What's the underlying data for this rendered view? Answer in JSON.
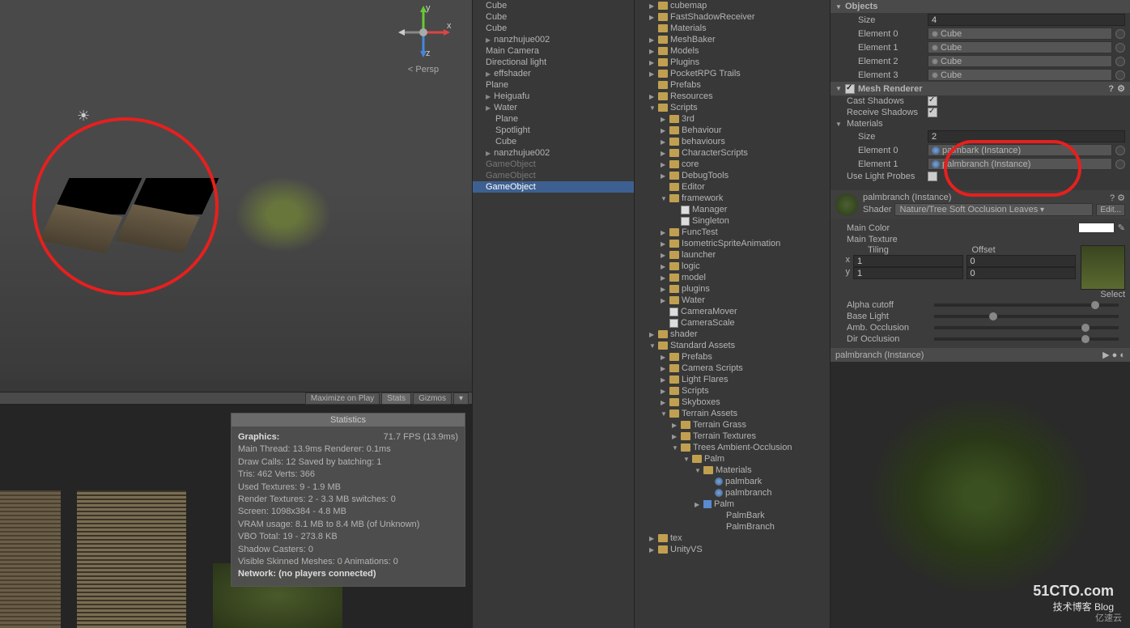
{
  "scene": {
    "gizmo_axes": {
      "x": "x",
      "y": "y",
      "z": "z"
    },
    "persp_label": "< Persp"
  },
  "game_toolbar": {
    "maximize": "Maximize on Play",
    "stats": "Stats",
    "gizmos": "Gizmos"
  },
  "stats": {
    "title": "Statistics",
    "graphics_label": "Graphics:",
    "fps": "71.7 FPS (13.9ms)",
    "line1": "Main Thread: 13.9ms   Renderer: 0.1ms",
    "line2": "Draw Calls: 12        Saved by batching: 1",
    "line3": "Tris: 462  Verts: 366",
    "line4": "Used Textures: 9 - 1.9 MB",
    "line5": "Render Textures: 2 - 3.3 MB      switches: 0",
    "line6": "Screen: 1098x384 - 4.8 MB",
    "line7": "VRAM usage: 8.1 MB to 8.4 MB (of Unknown)",
    "line8": "VBO Total: 19 - 273.8 KB",
    "line9": "Shadow Casters: 0",
    "line10": "Visible Skinned Meshes: 0        Animations: 0",
    "network": "Network: (no players connected)"
  },
  "hierarchy": [
    {
      "label": "Cube",
      "indent": 0
    },
    {
      "label": "Cube",
      "indent": 0
    },
    {
      "label": "Cube",
      "indent": 0
    },
    {
      "label": "nanzhujue002",
      "indent": 0,
      "expand": true
    },
    {
      "label": "Main Camera",
      "indent": 0
    },
    {
      "label": "Directional light",
      "indent": 0
    },
    {
      "label": "effshader",
      "indent": 0,
      "expand": true
    },
    {
      "label": "Plane",
      "indent": 0
    },
    {
      "label": "Heiguafu",
      "indent": 0,
      "expand": true
    },
    {
      "label": "Water",
      "indent": 0,
      "expand": true
    },
    {
      "label": "Plane",
      "indent": 1
    },
    {
      "label": "Spotlight",
      "indent": 1
    },
    {
      "label": "Cube",
      "indent": 1
    },
    {
      "label": "nanzhujue002",
      "indent": 0,
      "expand": true
    },
    {
      "label": "GameObject",
      "indent": 0,
      "dim": true
    },
    {
      "label": "GameObject",
      "indent": 0,
      "dim": true
    },
    {
      "label": "GameObject",
      "indent": 0,
      "sel": true
    }
  ],
  "project": [
    {
      "l": "cubemap",
      "i": 1,
      "f": true,
      "a": "▶"
    },
    {
      "l": "FastShadowReceiver",
      "i": 1,
      "f": true,
      "a": "▶"
    },
    {
      "l": "Materials",
      "i": 1,
      "f": true,
      "a": ""
    },
    {
      "l": "MeshBaker",
      "i": 1,
      "f": true,
      "a": "▶"
    },
    {
      "l": "Models",
      "i": 1,
      "f": true,
      "a": "▶"
    },
    {
      "l": "Plugins",
      "i": 1,
      "f": true,
      "a": "▶"
    },
    {
      "l": "PocketRPG Trails",
      "i": 1,
      "f": true,
      "a": "▶"
    },
    {
      "l": "Prefabs",
      "i": 1,
      "f": true,
      "a": ""
    },
    {
      "l": "Resources",
      "i": 1,
      "f": true,
      "a": "▶"
    },
    {
      "l": "Scripts",
      "i": 1,
      "f": true,
      "a": "▼"
    },
    {
      "l": "3rd",
      "i": 2,
      "f": true,
      "a": "▶"
    },
    {
      "l": "Behaviour",
      "i": 2,
      "f": true,
      "a": "▶"
    },
    {
      "l": "behaviours",
      "i": 2,
      "f": true,
      "a": "▶"
    },
    {
      "l": "CharacterScripts",
      "i": 2,
      "f": true,
      "a": "▶"
    },
    {
      "l": "core",
      "i": 2,
      "f": true,
      "a": "▶"
    },
    {
      "l": "DebugTools",
      "i": 2,
      "f": true,
      "a": "▶"
    },
    {
      "l": "Editor",
      "i": 2,
      "f": true,
      "a": ""
    },
    {
      "l": "framework",
      "i": 2,
      "f": true,
      "a": "▼"
    },
    {
      "l": "Manager",
      "i": 3,
      "s": true
    },
    {
      "l": "Singleton",
      "i": 3,
      "s": true
    },
    {
      "l": "FuncTest",
      "i": 2,
      "f": true,
      "a": "▶"
    },
    {
      "l": "IsometricSpriteAnimation",
      "i": 2,
      "f": true,
      "a": "▶"
    },
    {
      "l": "launcher",
      "i": 2,
      "f": true,
      "a": "▶"
    },
    {
      "l": "logic",
      "i": 2,
      "f": true,
      "a": "▶"
    },
    {
      "l": "model",
      "i": 2,
      "f": true,
      "a": "▶"
    },
    {
      "l": "plugins",
      "i": 2,
      "f": true,
      "a": "▶"
    },
    {
      "l": "Water",
      "i": 2,
      "f": true,
      "a": "▶"
    },
    {
      "l": "CameraMover",
      "i": 2,
      "s": true
    },
    {
      "l": "CameraScale",
      "i": 2,
      "s": true
    },
    {
      "l": "shader",
      "i": 1,
      "f": true,
      "a": "▶"
    },
    {
      "l": "Standard Assets",
      "i": 1,
      "f": true,
      "a": "▼"
    },
    {
      "l": "Prefabs",
      "i": 2,
      "f": true,
      "a": "▶"
    },
    {
      "l": "Camera Scripts",
      "i": 2,
      "f": true,
      "a": "▶"
    },
    {
      "l": "Light Flares",
      "i": 2,
      "f": true,
      "a": "▶"
    },
    {
      "l": "Scripts",
      "i": 2,
      "f": true,
      "a": "▶"
    },
    {
      "l": "Skyboxes",
      "i": 2,
      "f": true,
      "a": "▶"
    },
    {
      "l": "Terrain Assets",
      "i": 2,
      "f": true,
      "a": "▼"
    },
    {
      "l": "Terrain Grass",
      "i": 3,
      "f": true,
      "a": "▶"
    },
    {
      "l": "Terrain Textures",
      "i": 3,
      "f": true,
      "a": "▶"
    },
    {
      "l": "Trees Ambient-Occlusion",
      "i": 3,
      "f": true,
      "a": "▼"
    },
    {
      "l": "Palm",
      "i": 4,
      "f": true,
      "a": "▼"
    },
    {
      "l": "Materials",
      "i": 5,
      "f": true,
      "a": "▼"
    },
    {
      "l": "palmbark",
      "i": 6,
      "m": true
    },
    {
      "l": "palmbranch",
      "i": 6,
      "m": true
    },
    {
      "l": "Palm",
      "i": 5,
      "p": true,
      "a": "▶"
    },
    {
      "l": "PalmBark",
      "i": 6
    },
    {
      "l": "PalmBranch",
      "i": 6
    },
    {
      "l": "tex",
      "i": 1,
      "f": true,
      "a": "▶"
    },
    {
      "l": "UnityVS",
      "i": 1,
      "f": true,
      "a": "▶"
    }
  ],
  "inspector": {
    "objects_header": "Objects",
    "objects": {
      "size_label": "Size",
      "size": "4",
      "elements": [
        {
          "label": "Element 0",
          "val": "Cube"
        },
        {
          "label": "Element 1",
          "val": "Cube"
        },
        {
          "label": "Element 2",
          "val": "Cube"
        },
        {
          "label": "Element 3",
          "val": "Cube"
        }
      ]
    },
    "mesh_renderer": {
      "title": "Mesh Renderer",
      "cast_shadows": "Cast Shadows",
      "receive_shadows": "Receive Shadows",
      "materials": "Materials",
      "size_label": "Size",
      "size": "2",
      "el0_label": "Element 0",
      "el0_val": "palmbark (Instance)",
      "el1_label": "Element 1",
      "el1_val": "palmbranch (Instance)",
      "light_probes": "Use Light Probes"
    },
    "material": {
      "name": "palmbranch (Instance)",
      "shader_label": "Shader",
      "shader": "Nature/Tree Soft Occlusion Leaves",
      "edit": "Edit...",
      "main_color": "Main Color",
      "main_texture": "Main Texture",
      "tiling": "Tiling",
      "offset": "Offset",
      "x": "x",
      "y": "y",
      "x_tile": "1",
      "x_off": "0",
      "y_tile": "1",
      "y_off": "0",
      "select": "Select",
      "alpha_cutoff": "Alpha cutoff",
      "base_light": "Base Light",
      "amb_occlusion": "Amb. Occlusion",
      "dir_occlusion": "Dir Occlusion"
    },
    "preview_title": "palmbranch (Instance)"
  },
  "watermarks": {
    "w1": "51CTO.com",
    "w2": "技术博客    Blog",
    "w3": "亿速云"
  }
}
